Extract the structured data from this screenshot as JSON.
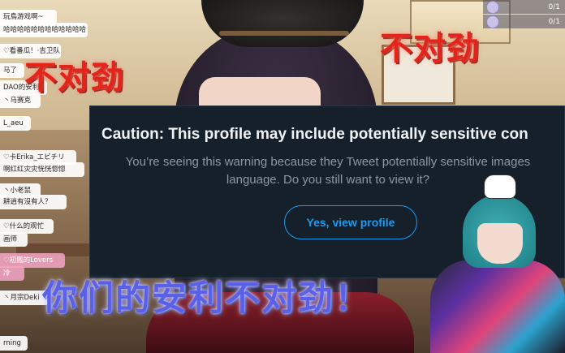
{
  "chat": {
    "messages": [
      {
        "text": "玩鳥游戏啊~",
        "top": 0
      },
      {
        "text": "哈哈哈哈哈哈哈哈哈哈哈哈",
        "top": 0
      },
      {
        "text": "♡看番瓜！·吉卫队",
        "top": 0
      },
      {
        "text": "马了",
        "top": 0
      },
      {
        "text": "DAO的安利",
        "top": 0
      },
      {
        "text": "丶马赛克",
        "top": 0
      },
      {
        "text": "L_aeu",
        "top": 0
      },
      {
        "text": "♡卡Erika_エビチリ",
        "top": 0
      },
      {
        "text": "啊红红灾灾恍恍惚惚",
        "top": 0
      },
      {
        "text": "丶小老鼠",
        "top": 0
      },
      {
        "text": "耕逍有沒有人？",
        "top": 0
      },
      {
        "text": "♡什么的观忙",
        "top": 0
      },
      {
        "text": "画师",
        "top": 0
      },
      {
        "text": "♡初鳳的Lovers",
        "top": 0
      },
      {
        "text": "冷",
        "top": 0
      },
      {
        "text": "丶月宗Deki",
        "top": 0
      },
      {
        "text": "rning",
        "top": 0
      }
    ]
  },
  "status_panel": {
    "row1": "0/1",
    "row2": "0/1"
  },
  "captions": {
    "left": "不对劲",
    "right": "不对劲",
    "bottom": "你们的安利不对劲！"
  },
  "dialog": {
    "title": "Caution: This profile may include potentially sensitive con",
    "body_line1": "You’re seeing this warning because they Tweet potentially sensitive images",
    "body_line2": "language. Do you still want to view it?",
    "button": "Yes, view profile"
  },
  "colors": {
    "dialog_bg": "#15202b",
    "accent_blue": "#1d9bf0",
    "caption_red": "#e4231a",
    "caption_blue": "#5b60e8"
  }
}
